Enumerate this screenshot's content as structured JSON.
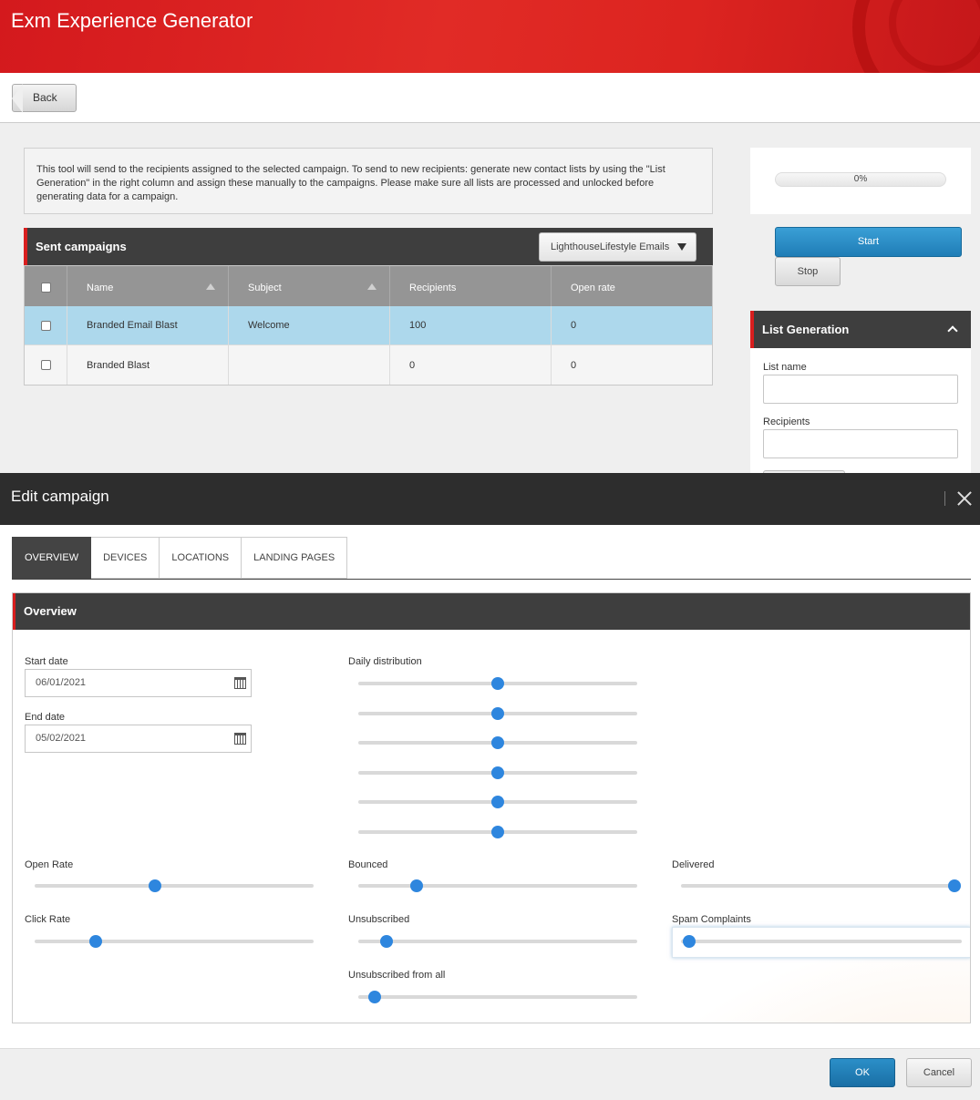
{
  "app": {
    "title": "Exm Experience Generator"
  },
  "toolbar": {
    "back_label": "Back"
  },
  "info": {
    "text": "This tool will send to the recipients assigned to the selected campaign. To send to new recipients: generate new contact lists by using the \"List Generation\" in the right column and assign these manually to the campaigns. Please make sure all lists are processed and unlocked before generating data for a campaign."
  },
  "campaigns": {
    "title": "Sent campaigns",
    "selected_manager": "LighthouseLifestyle Emails",
    "columns": [
      "Name",
      "Subject",
      "Recipients",
      "Open rate"
    ],
    "rows": [
      {
        "name": "Branded Email Blast",
        "subject": "Welcome",
        "recipients": "100",
        "open_rate": "0",
        "selected": true
      },
      {
        "name": "Branded Blast",
        "subject": "",
        "recipients": "0",
        "open_rate": "0",
        "selected": false
      }
    ]
  },
  "progress": {
    "text": "0%",
    "value": 0
  },
  "actions": {
    "start_label": "Start",
    "stop_label": "Stop"
  },
  "list_generation": {
    "title": "List Generation",
    "list_name_label": "List name",
    "recipients_label": "Recipients"
  },
  "modal": {
    "title": "Edit campaign",
    "tabs": [
      "OVERVIEW",
      "DEVICES",
      "LOCATIONS",
      "LANDING PAGES"
    ],
    "active_tab": "OVERVIEW",
    "section_title": "Overview",
    "start_date_label": "Start date",
    "start_date": "06/01/2021",
    "end_date_label": "End date",
    "end_date": "05/02/2021",
    "daily_distribution_label": "Daily distribution",
    "daily_distribution_values": [
      0.5,
      0.5,
      0.5,
      0.5,
      0.5,
      0.5
    ],
    "sliders": {
      "open_rate": {
        "label": "Open Rate",
        "value": 0.43
      },
      "click_rate": {
        "label": "Click Rate",
        "value": 0.22
      },
      "bounced": {
        "label": "Bounced",
        "value": 0.21
      },
      "unsubscribed": {
        "label": "Unsubscribed",
        "value": 0.1
      },
      "unsubscribed_all": {
        "label": "Unsubscribed from all",
        "value": 0.06
      },
      "delivered": {
        "label": "Delivered",
        "value": 1.0
      },
      "spam": {
        "label": "Spam Complaints",
        "value": 0.03
      }
    }
  },
  "footer": {
    "ok_label": "OK",
    "cancel_label": "Cancel"
  },
  "colors": {
    "brand_red": "#d81e1e",
    "primary_blue": "#2e86de",
    "selected_row": "#add8ec"
  }
}
